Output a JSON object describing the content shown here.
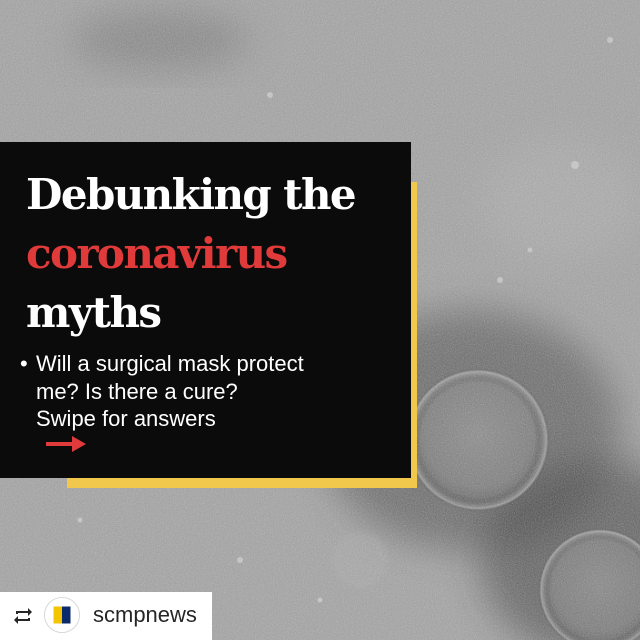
{
  "headline": {
    "line1": "Debunking the",
    "line2": "coronavirus",
    "line3": "myths"
  },
  "bullet": {
    "marker": "•",
    "line1": "Will a surgical mask protect",
    "line2": "me? Is there a cure?",
    "line3": "Swipe for answers"
  },
  "repost": {
    "icon": "repost-icon",
    "username": "scmpnews"
  },
  "colors": {
    "accent_red": "#e03a3a",
    "accent_yellow": "#f1c84b",
    "card_black": "#0b0b0b"
  }
}
